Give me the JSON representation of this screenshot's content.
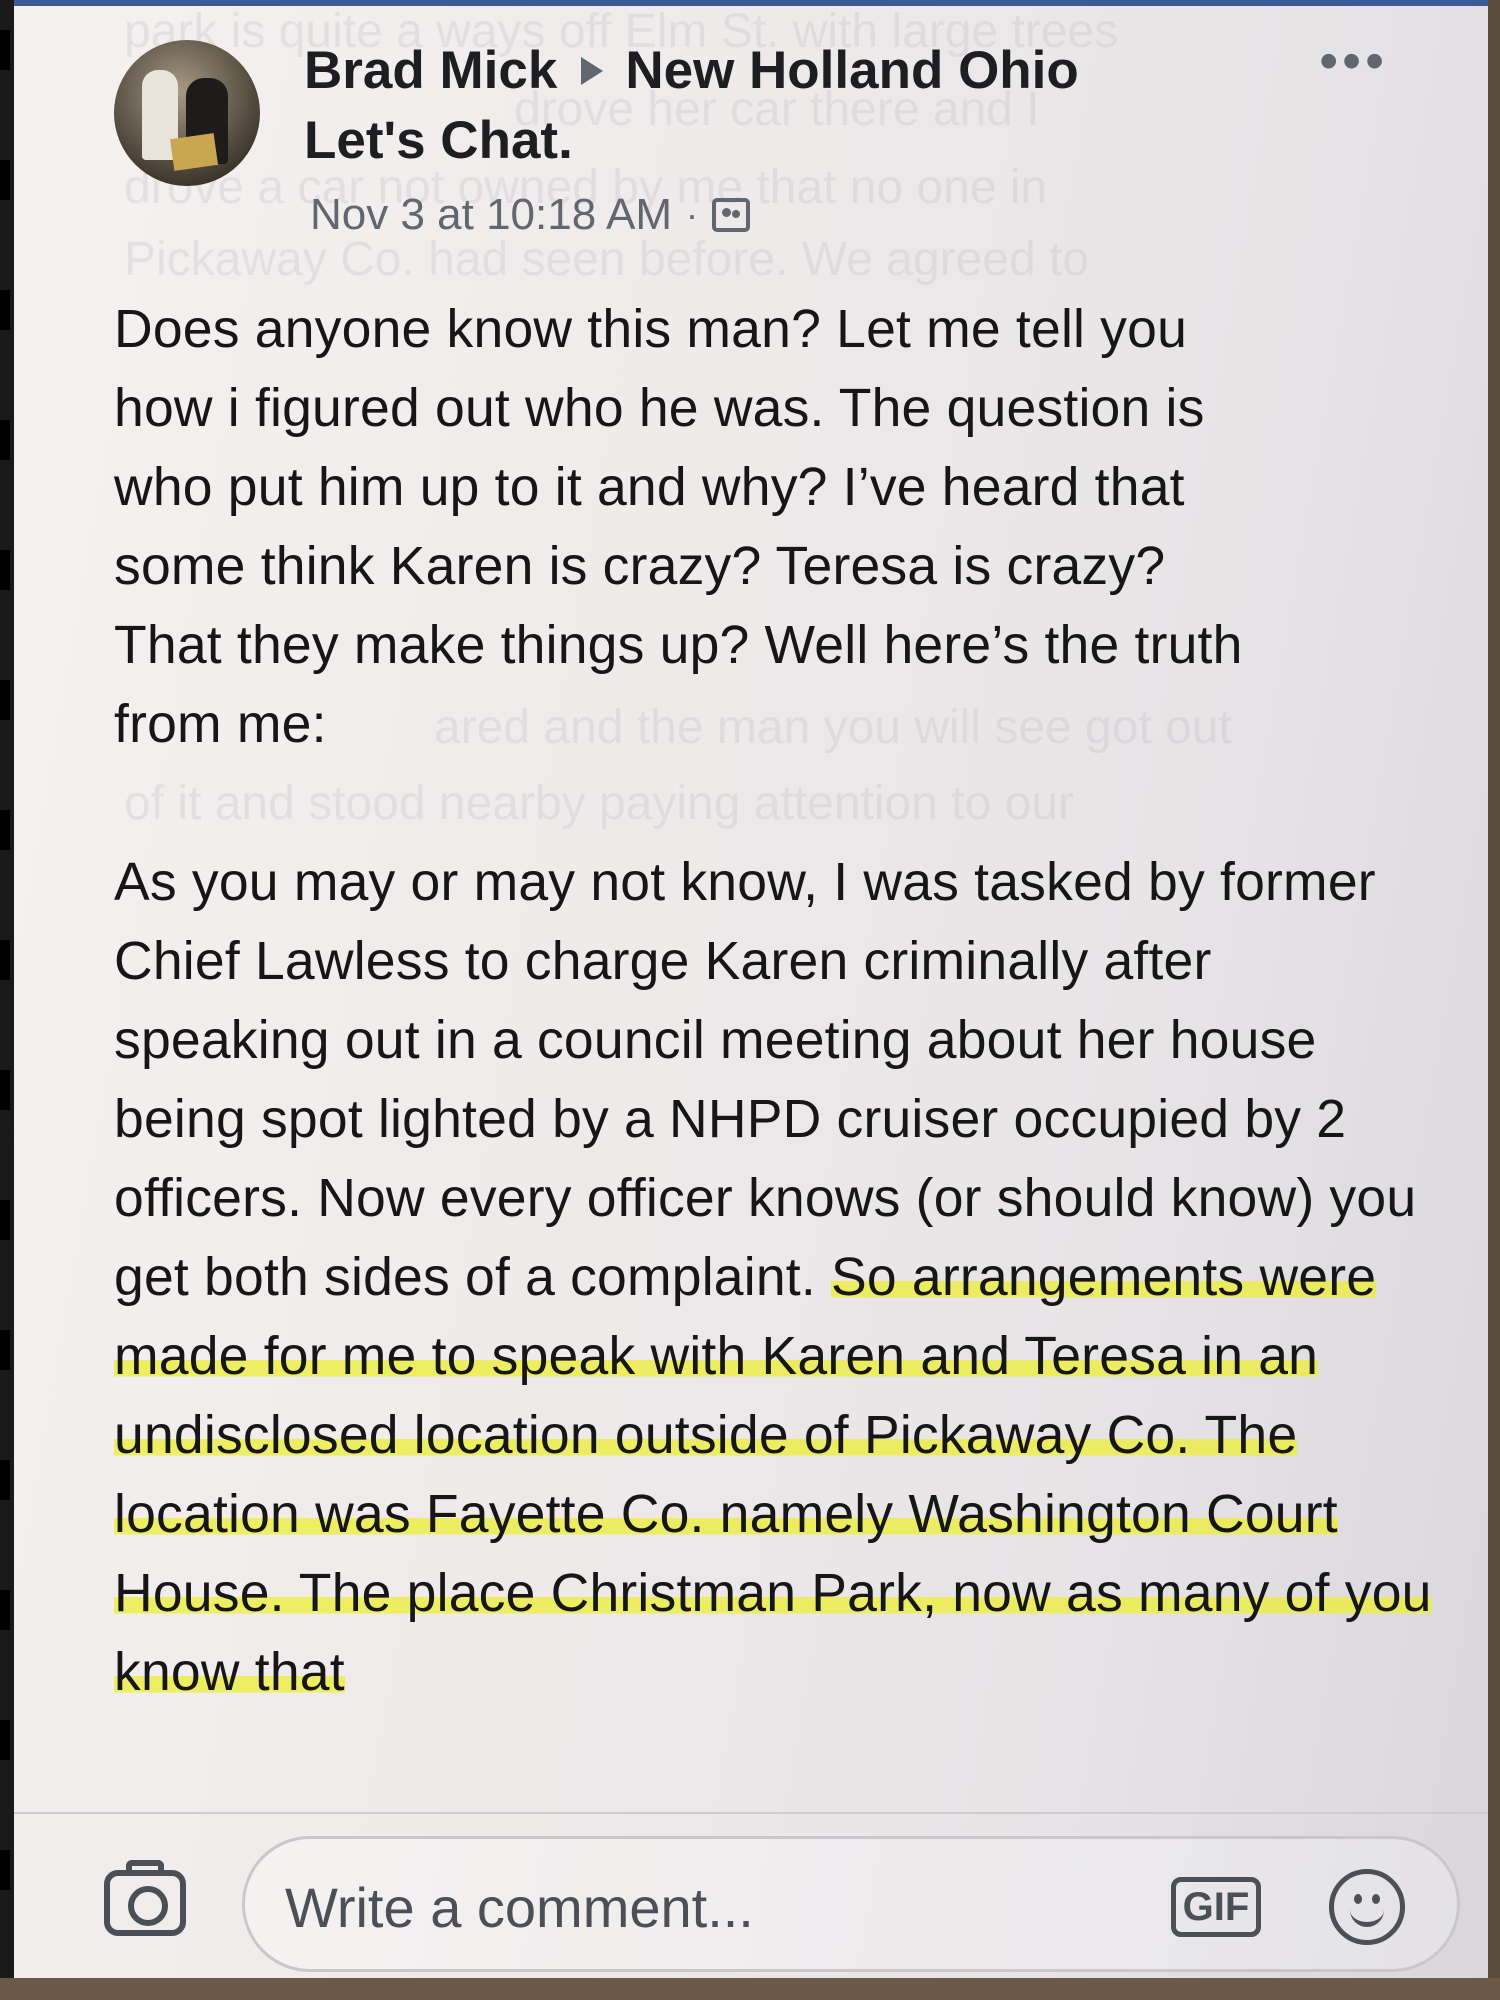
{
  "post": {
    "author": "Brad Mick",
    "group_name": "New Holland Ohio",
    "group_name_line2": "Let's Chat.",
    "timestamp": "Nov 3 at 10:18 AM",
    "separator": "·",
    "audience_icon": "group-audience-icon",
    "more_label": "•••",
    "paragraphs": [
      {
        "lines": [
          "Does anyone know this man? Let me tell you",
          "how i figured out who he was. The question is",
          "who put him up to it and why? I’ve heard that",
          "some think Karen is crazy? Teresa is crazy?",
          "That they make things up? Well here’s the truth",
          "from me:"
        ]
      },
      {
        "plain": "As you may or may not know, I was tasked by former Chief Lawless to charge Karen criminally after speaking out in a council meeting about her house being spot lighted by a NHPD cruiser occupied by 2 officers. Now every officer knows (or should know) you get both sides of a complaint. ",
        "highlighted": "So arrangements were made for me to speak with Karen and Teresa in an undisclosed location outside of Pickaway Co. The location was Fayette Co. namely Washington Court House. The place Christman Park, now as many of you know that"
      }
    ]
  },
  "bleed_through": [
    "park is quite a ways off Elm St. with large trees",
    "drove her car there and I",
    "drove a car not owned by me that no one in",
    "Pickaway Co. had seen before. We agreed to",
    "ared and the man you will see got out",
    "of it and stood nearby paying attention to our"
  ],
  "comment_bar": {
    "placeholder": "Write a comment...",
    "gif_label": "GIF",
    "camera_icon": "camera-icon",
    "emoji_icon": "emoji-icon"
  },
  "colors": {
    "highlight": "#ecee3c",
    "text": "#161616",
    "meta": "#606770"
  }
}
